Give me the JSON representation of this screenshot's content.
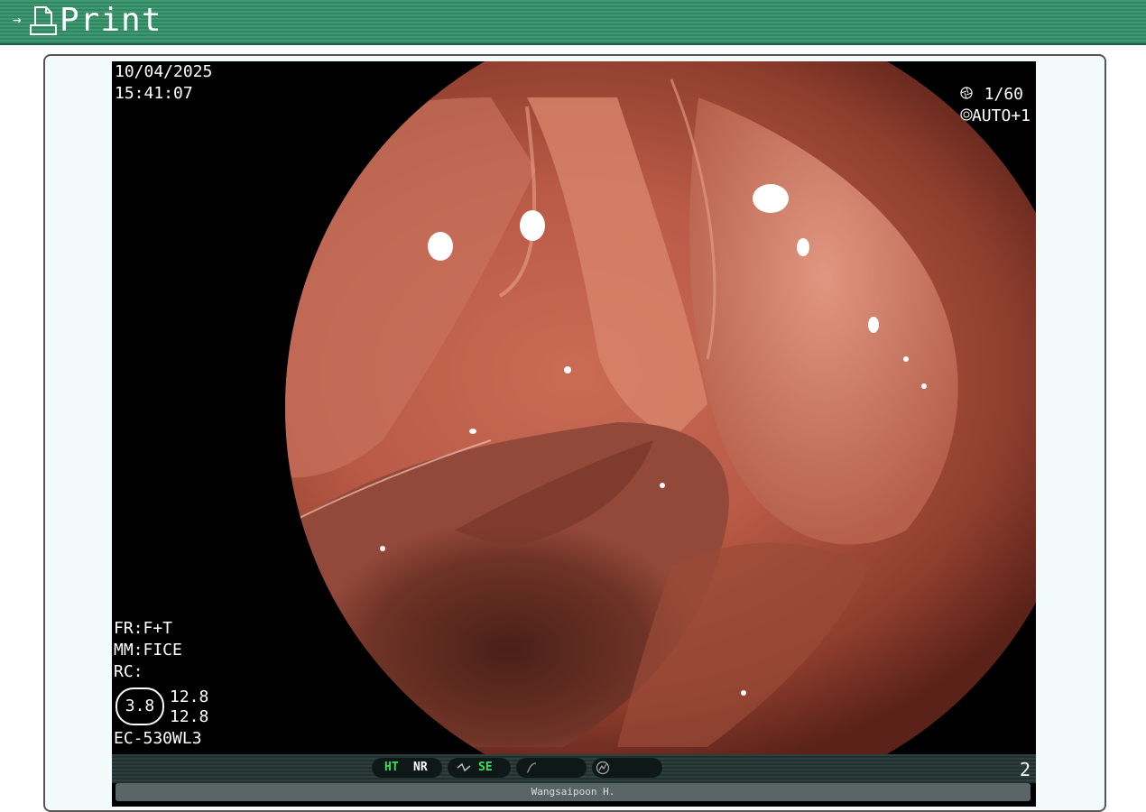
{
  "header": {
    "title": "Print",
    "arrow": "→",
    "print_icon": "print-document-icon"
  },
  "overlay": {
    "date": "10/04/2025",
    "time": "15:41:07",
    "shutter": "1/60",
    "shutter_icon": "aperture-icon",
    "exposure": "AUTO+1",
    "exposure_icon": "iris-icon",
    "fr": "FR:F+T",
    "mm": "MM:FICE",
    "rc": "RC:",
    "zoom": "3.8",
    "zoom_a": "12.8",
    "zoom_b": "12.8",
    "scope_model": "EC-530WL3"
  },
  "status_bar": {
    "ht": "HT",
    "nr": "NR",
    "se": "SE",
    "page_number": "2",
    "operator": "Wangsaipoon H."
  },
  "colors": {
    "header_green": "#2f8661",
    "status_green": "#36e05a",
    "panel_bg": "#f2fbfa"
  }
}
